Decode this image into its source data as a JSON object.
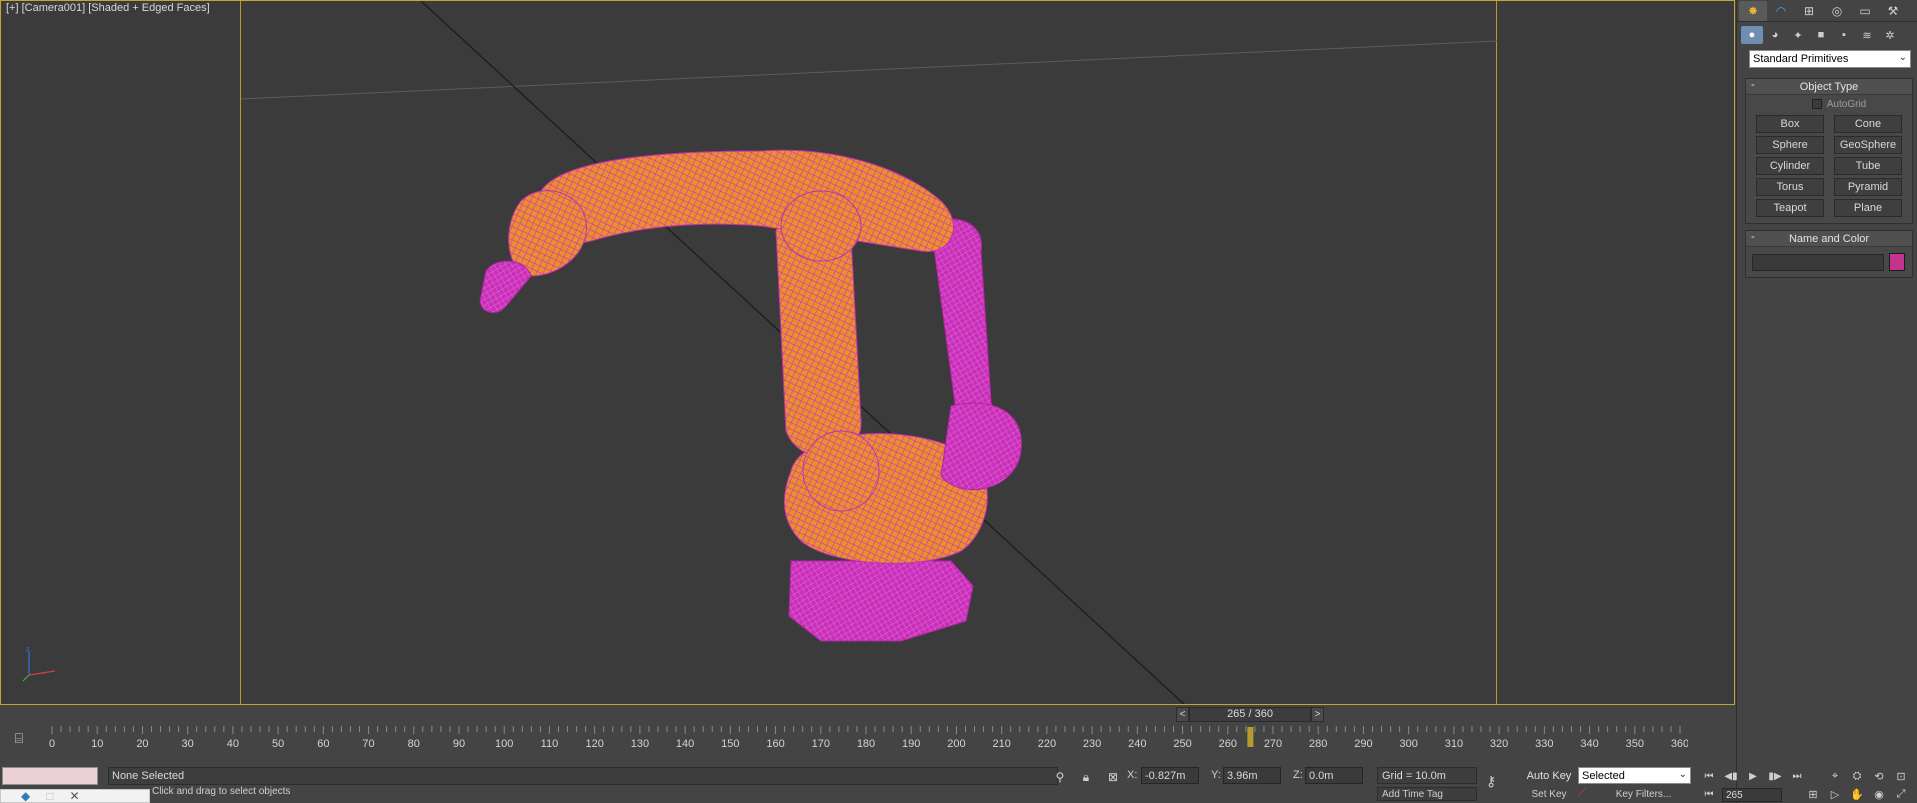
{
  "viewport": {
    "label": "[+] [Camera001] [Shaded + Edged Faces]"
  },
  "command_panel": {
    "main_tabs": [
      {
        "name": "create",
        "glyph": "✸"
      },
      {
        "name": "modify",
        "glyph": "◠"
      },
      {
        "name": "hierarchy",
        "glyph": "⊞"
      },
      {
        "name": "motion",
        "glyph": "◎"
      },
      {
        "name": "display",
        "glyph": "▭"
      },
      {
        "name": "utilities",
        "glyph": "⚒"
      }
    ],
    "sub_tabs": [
      {
        "name": "geometry",
        "glyph": "●"
      },
      {
        "name": "shapes",
        "glyph": "◕"
      },
      {
        "name": "lights",
        "glyph": "✦"
      },
      {
        "name": "cameras",
        "glyph": "■"
      },
      {
        "name": "helpers",
        "glyph": "▪"
      },
      {
        "name": "space-warps",
        "glyph": "≋"
      },
      {
        "name": "systems",
        "glyph": "✲"
      }
    ],
    "category": "Standard Primitives",
    "object_type": {
      "title": "Object Type",
      "autogrid_label": "AutoGrid",
      "buttons": [
        "Box",
        "Cone",
        "Sphere",
        "GeoSphere",
        "Cylinder",
        "Tube",
        "Torus",
        "Pyramid",
        "Teapot",
        "Plane"
      ]
    },
    "name_and_color": {
      "title": "Name and Color",
      "name_value": "",
      "color": "#c2348d"
    },
    "rollout_toggle": "-"
  },
  "time_slider": {
    "prev": "<",
    "next": ">",
    "frame_display": "265 / 360",
    "current_frame": 265,
    "max_frame": 360
  },
  "trackbar": {
    "tick_labels": [
      "0",
      "10",
      "20",
      "30",
      "40",
      "50",
      "60",
      "70",
      "80",
      "90",
      "100",
      "110",
      "120",
      "130",
      "140",
      "150",
      "160",
      "170",
      "180",
      "190",
      "200",
      "210",
      "220",
      "230",
      "240",
      "250",
      "260",
      "270",
      "280",
      "290",
      "300",
      "310",
      "320",
      "330",
      "340",
      "350",
      "360"
    ]
  },
  "status": {
    "selection": "None Selected",
    "prompt": "Click and drag to select objects",
    "x_label": "X:",
    "x_value": "-0.827m",
    "y_label": "Y:",
    "y_value": "3.96m",
    "z_label": "Z:",
    "z_value": "0.0m",
    "grid": "Grid = 10.0m",
    "add_time_tag": "Add Time Tag",
    "auto_key": "Auto Key",
    "set_key": "Set Key",
    "key_mode": "Selected",
    "key_filters": "Key Filters...",
    "frame_value": "265"
  },
  "colors": {
    "viewport_bg": "#3b3b3b",
    "safe_frame": "#b69a31",
    "robot_wire": "#d42fc0",
    "robot_shade": "#e8902a",
    "ui_bg": "#444444"
  }
}
